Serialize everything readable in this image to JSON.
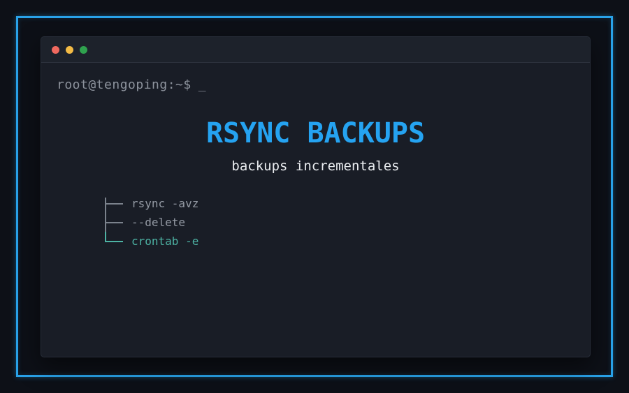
{
  "page": {
    "background": "#0d1017",
    "frame_color": "#29a2e9"
  },
  "window": {
    "titlebar": {
      "buttons": [
        {
          "name": "close",
          "color": "#f0695f"
        },
        {
          "name": "minimize",
          "color": "#f3bb45"
        },
        {
          "name": "maximize",
          "color": "#2fa24e"
        }
      ]
    },
    "prompt": {
      "text": "root@tengoping:~$",
      "cursor": "_",
      "color": "#8d939d"
    },
    "hero": {
      "title": "RSYNC BACKUPS",
      "title_color": "#25a3f1",
      "subtitle": "backups incrementales",
      "subtitle_color": "#e9ecef"
    },
    "tree": {
      "items": [
        {
          "prefix": "├──",
          "label": "rsync -avz",
          "color": "#949aa4"
        },
        {
          "prefix": "├──",
          "label": "--delete",
          "color": "#949aa4"
        },
        {
          "prefix": "└──",
          "label": "crontab -e",
          "color": "#4db3a4"
        }
      ]
    }
  }
}
